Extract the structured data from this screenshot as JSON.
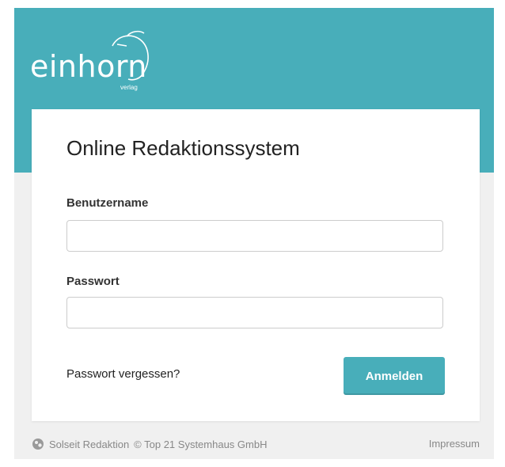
{
  "header": {
    "logo_text": "einhorn",
    "logo_subtext": "verlag"
  },
  "login": {
    "title": "Online Redaktionssystem",
    "username_label": "Benutzername",
    "username_value": "",
    "password_label": "Passwort",
    "password_value": "",
    "forgot_link": "Passwort vergessen?",
    "submit_label": "Anmelden"
  },
  "footer": {
    "product": "Solseit Redaktion",
    "copyright": "© Top 21 Systemhaus GmbH",
    "imprint_link": "Impressum"
  },
  "colors": {
    "accent": "#48aeba",
    "background": "#f0f0f0",
    "card": "#ffffff"
  }
}
